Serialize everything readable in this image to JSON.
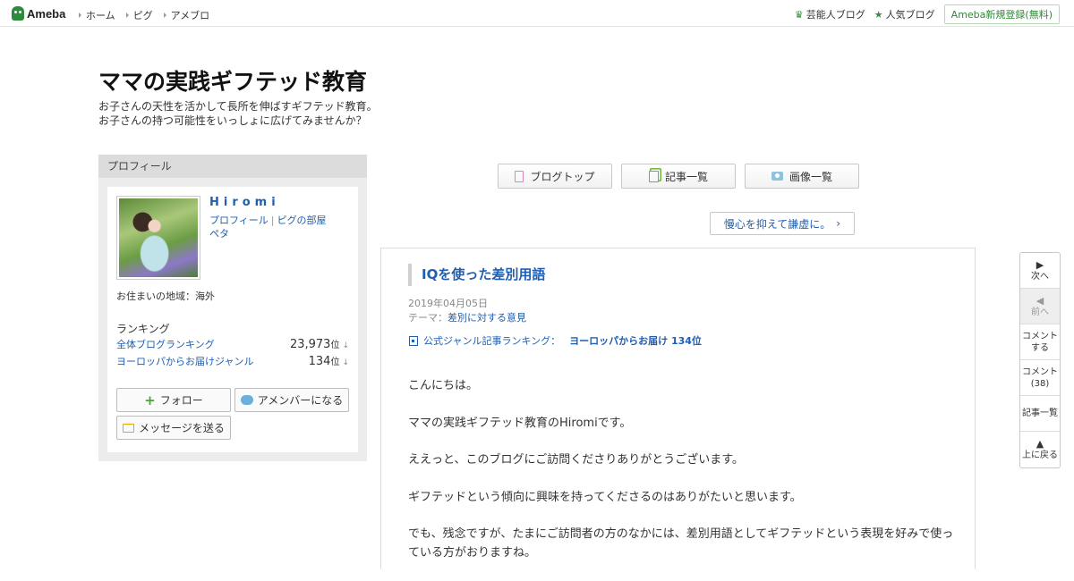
{
  "topbar": {
    "logo_text": "Ameba",
    "nav": [
      "ホーム",
      "ピグ",
      "アメブロ"
    ],
    "right_links": [
      {
        "icon": "crown-icon",
        "label": "芸能人ブログ"
      },
      {
        "icon": "star-icon",
        "label": "人気ブログ"
      }
    ],
    "register_label": "Ameba新規登録(無料)"
  },
  "blog": {
    "title": "ママの実践ギフテッド教育",
    "description_line1": "お子さんの天性を活かして長所を伸ばすギフテッド教育。",
    "description_line2": "お子さんの持つ可能性をいっしょに広げてみませんか？"
  },
  "profile": {
    "heading": "プロフィール",
    "name": "Hiromi",
    "link_profile": "プロフィール",
    "link_room": "ピグの部屋",
    "link_peta": "ペタ",
    "residence": "お住まいの地域：海外",
    "ranking_heading": "ランキング",
    "rankings": [
      {
        "label": "全体ブログランキング",
        "value": "23,973",
        "unit": "位",
        "arrow": "↓"
      },
      {
        "label": "ヨーロッパからお届けジャンル",
        "value": "134",
        "unit": "位",
        "arrow": "↓"
      }
    ],
    "follow_label": "フォロー",
    "amember_label": "アメンバーになる",
    "message_label": "メッセージを送る"
  },
  "content_nav": {
    "blog_top": "ブログトップ",
    "entry_list": "記事一覧",
    "image_list": "画像一覧",
    "prev_entry": "慢心を抑えて謙虚に。"
  },
  "article": {
    "title": "IQを使った差別用語",
    "date": "2019年04月05日",
    "theme_label": "テーマ：",
    "theme": "差別に対する意見",
    "genre_rank_label": "公式ジャンル記事ランキング：",
    "genre_rank_value": "ヨーロッパからお届け 134位",
    "paragraphs": [
      "こんにちは。",
      "ママの実践ギフテッド教育のHiromiです。",
      "ええっと、このブログにご訪問くださりありがとうございます。",
      "ギフテッドという傾向に興味を持ってくださるのはありがたいと思います。",
      "でも、残念ですが、たまにご訪問者の方のなかには、差別用語としてギフテッドという表現を好みで使っている方がおりますね。"
    ]
  },
  "side_tools": {
    "next": "次へ",
    "prev": "前へ",
    "comment_line1": "コメント",
    "comment_line2": "する",
    "comments_line1": "コメント",
    "comments_line2": "(38)",
    "entry_list": "記事一覧",
    "back_top": "上に戻る"
  },
  "colors": {
    "link": "#1f5fb0",
    "ameba_green": "#2d8c3c",
    "sidebar_bg": "#ececec"
  }
}
